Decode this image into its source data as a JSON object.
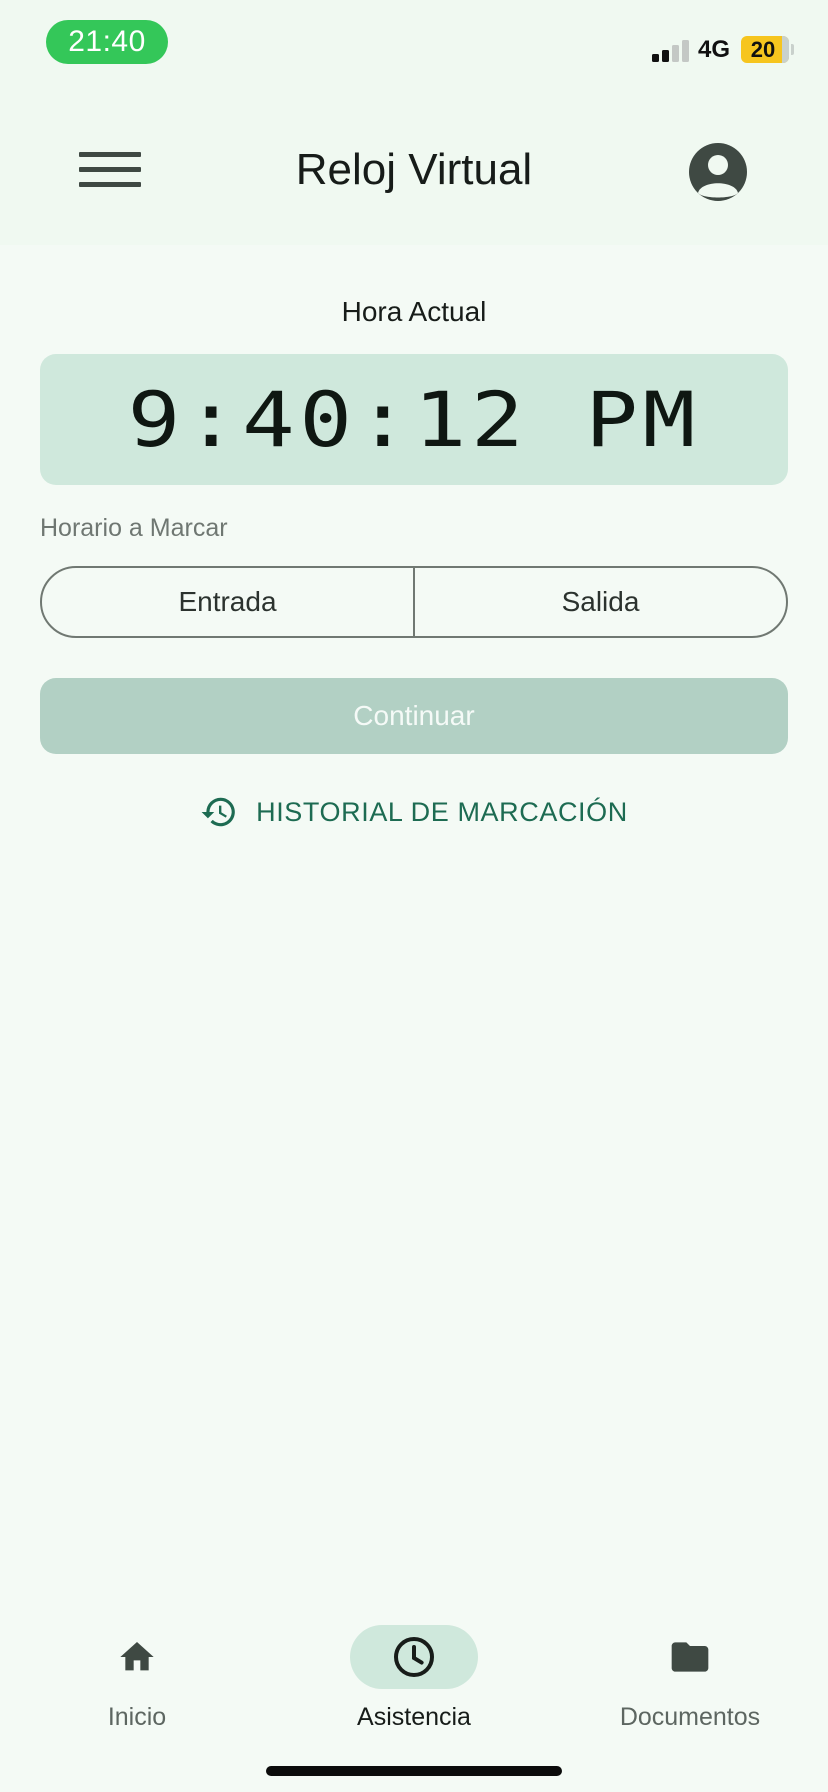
{
  "status_bar": {
    "time": "21:40",
    "network": "4G",
    "battery": "20"
  },
  "header": {
    "title": "Reloj Virtual"
  },
  "clock": {
    "label": "Hora Actual",
    "time": "9:40:12 PM"
  },
  "schedule": {
    "label": "Horario a Marcar",
    "options": [
      "Entrada",
      "Salida"
    ]
  },
  "actions": {
    "continue_label": "Continuar",
    "history_label": "HISTORIAL DE MARCACIÓN"
  },
  "bottom_nav": {
    "items": [
      {
        "label": "Inicio",
        "icon": "home-icon"
      },
      {
        "label": "Asistencia",
        "icon": "clock-icon"
      },
      {
        "label": "Documentos",
        "icon": "folder-icon"
      }
    ],
    "active": "Asistencia"
  },
  "colors": {
    "accent": "#1d6b52",
    "status_time_bg": "#34c759",
    "clock_bg": "#cfe8dc",
    "battery_bg": "#f6c51e"
  }
}
